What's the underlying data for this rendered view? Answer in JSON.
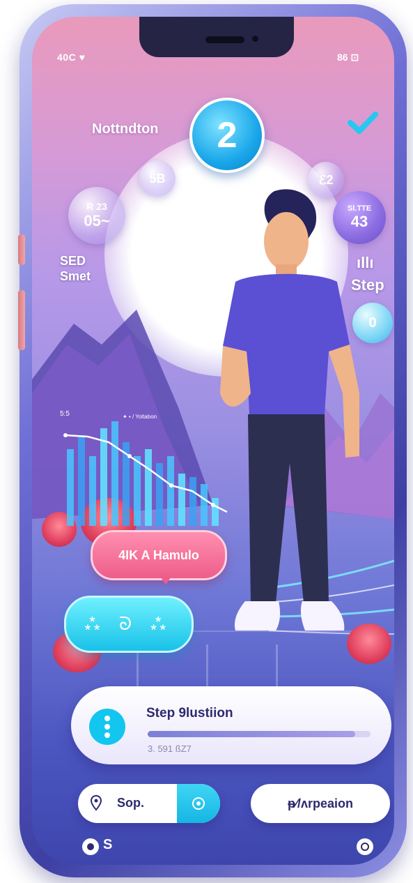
{
  "status_bar": {
    "left": "40C ♥",
    "right": "86 ⊡"
  },
  "header": {
    "title": "Nottndton",
    "badge_number": "2"
  },
  "bubbles": {
    "top_left": "5B",
    "top_right": "ℰ2",
    "left_top": "R 23",
    "left_value": "05~",
    "right_top": "Sl.TTE",
    "right_value": "43",
    "right_icon": "0"
  },
  "left_stats": {
    "line1": "SED",
    "line2": "Smet"
  },
  "right_stats": {
    "bars": "ıllı",
    "label": "Step"
  },
  "chart": {
    "y_label": "5:5",
    "annotation": "✦ • / Yoltabon"
  },
  "speech": {
    "label": "4IK A Hamulo"
  },
  "cyan_button": {
    "label": "⁂ ᘐ ⁂"
  },
  "step_card": {
    "title": "Step 9lustiion",
    "value": "3. 591 ßZ7",
    "progress": 0.93
  },
  "bottom_pills": {
    "left_label": "Sop.",
    "right_label": "ᵽ∕/ʌrpeaion"
  },
  "bottom_bar": {
    "left_label": "S"
  },
  "colors": {
    "accent_cyan": "#19c2e8",
    "accent_pink": "#ee5d8b",
    "card_text": "#2d2a6e"
  }
}
